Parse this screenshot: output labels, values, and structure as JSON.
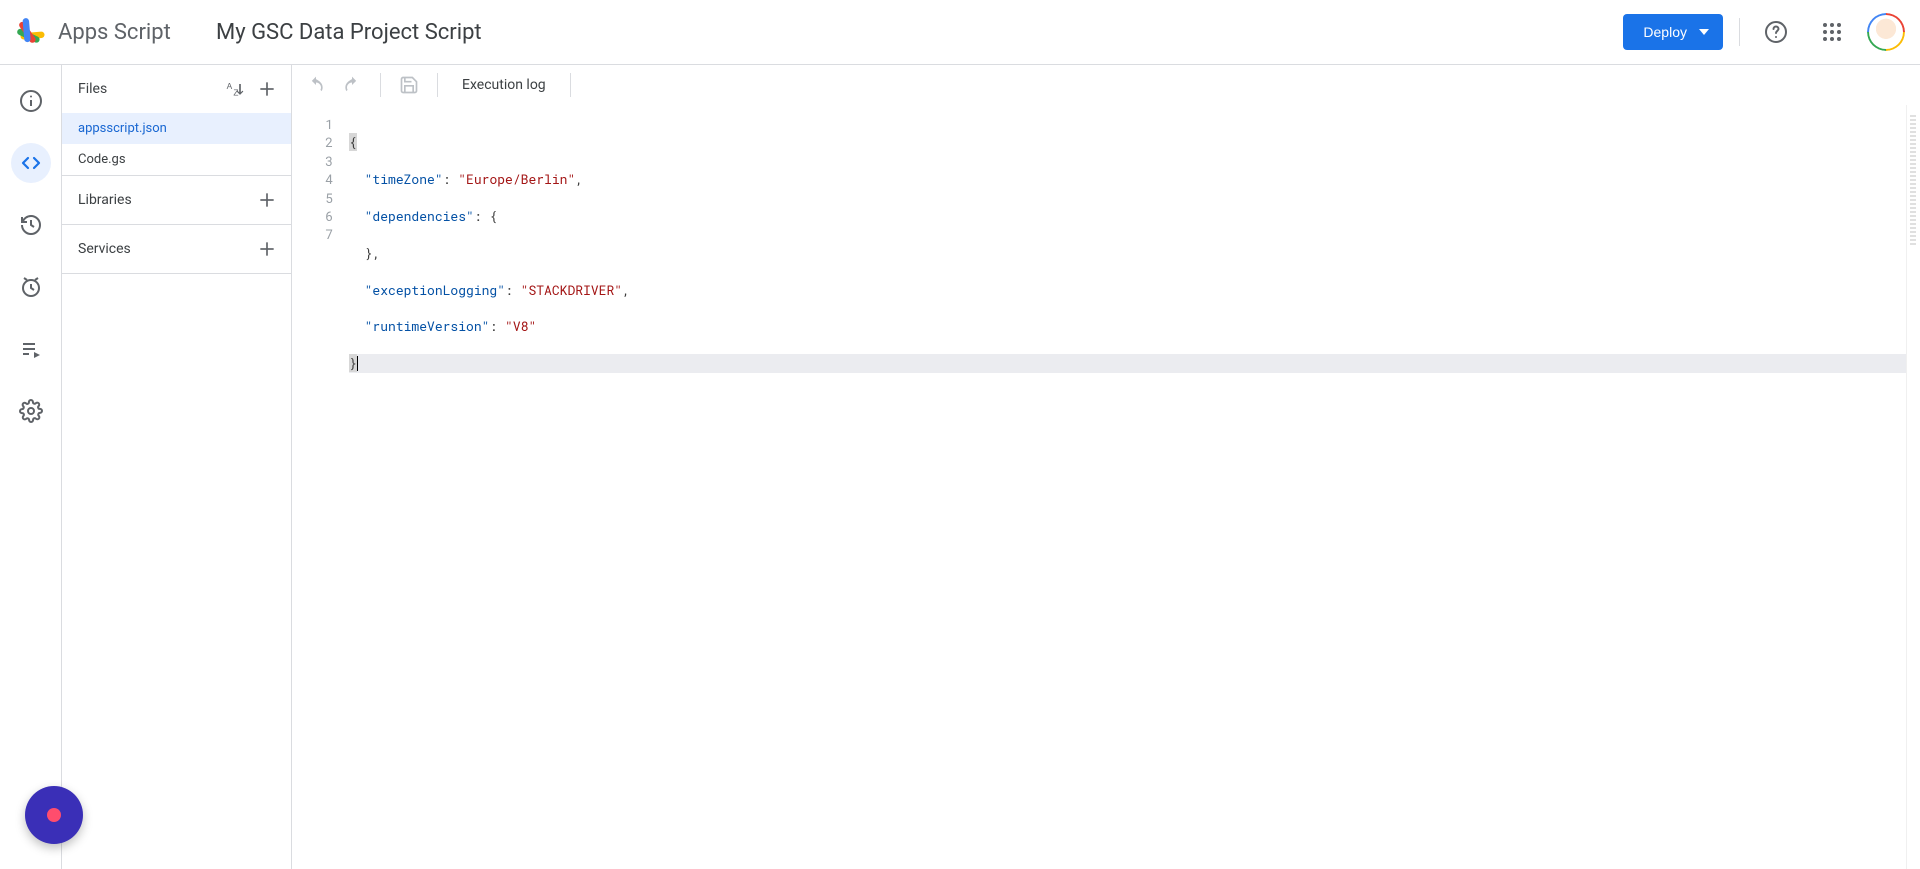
{
  "header": {
    "product_name": "Apps Script",
    "project_title": "My GSC Data Project Script",
    "deploy_label": "Deploy"
  },
  "rail": {
    "items": [
      {
        "name": "overview",
        "icon": "info-icon"
      },
      {
        "name": "editor",
        "icon": "code-icon"
      },
      {
        "name": "triggers",
        "icon": "clock-icon"
      },
      {
        "name": "executions",
        "icon": "history-icon"
      },
      {
        "name": "actions",
        "icon": "playlist-icon"
      },
      {
        "name": "settings",
        "icon": "gear-icon"
      }
    ]
  },
  "panel": {
    "files_label": "Files",
    "files": [
      {
        "name": "appsscript.json",
        "selected": true
      },
      {
        "name": "Code.gs",
        "selected": false
      }
    ],
    "libraries_label": "Libraries",
    "services_label": "Services"
  },
  "toolbar": {
    "exec_log_label": "Execution log"
  },
  "editor": {
    "line_numbers": [
      "1",
      "2",
      "3",
      "4",
      "5",
      "6",
      "7"
    ],
    "tokens": {
      "l1": "{",
      "l2_key": "\"timeZone\"",
      "l2_colon": ": ",
      "l2_val": "\"Europe/Berlin\"",
      "l2_end": ",",
      "l3_key": "\"dependencies\"",
      "l3_colon": ": ",
      "l3_val": "{",
      "l4": "},",
      "l5_key": "\"exceptionLogging\"",
      "l5_colon": ": ",
      "l5_val": "\"STACKDRIVER\"",
      "l5_end": ",",
      "l6_key": "\"runtimeVersion\"",
      "l6_colon": ": ",
      "l6_val": "\"V8\"",
      "l7": "}"
    }
  }
}
